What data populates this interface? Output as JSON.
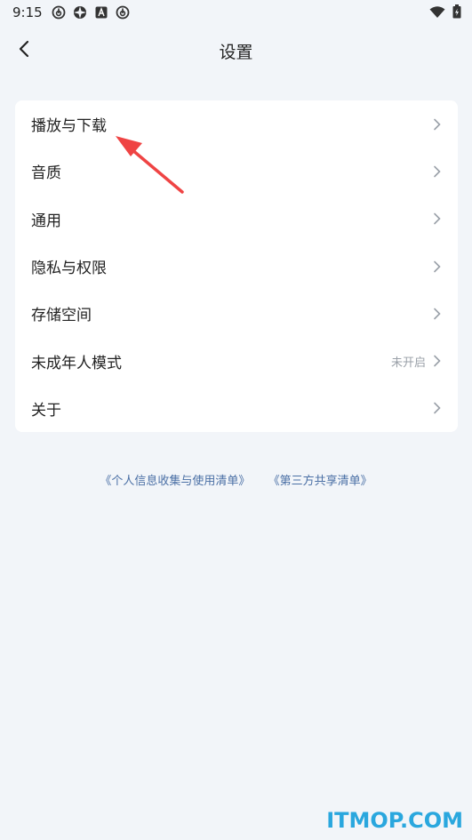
{
  "status_bar": {
    "time": "9:15",
    "left_icons": [
      "netease-music-icon",
      "aperture-icon",
      "text-app-icon",
      "netease-music-icon"
    ],
    "right_icons": [
      "wifi-icon",
      "battery-icon"
    ]
  },
  "header": {
    "title": "设置",
    "back_icon": "chevron-left-icon"
  },
  "settings_items": [
    {
      "label": "播放与下载",
      "value": ""
    },
    {
      "label": "音质",
      "value": ""
    },
    {
      "label": "通用",
      "value": ""
    },
    {
      "label": "隐私与权限",
      "value": ""
    },
    {
      "label": "存储空间",
      "value": ""
    },
    {
      "label": "未成年人模式",
      "value": "未开启"
    },
    {
      "label": "关于",
      "value": ""
    }
  ],
  "footer_links": [
    "《个人信息收集与使用清单》",
    "《第三方共享清单》"
  ],
  "watermark": "ITMOP.COM",
  "colors": {
    "background": "#f2f5f9",
    "card": "#ffffff",
    "link": "#4a6fa5",
    "annotation_arrow": "#ef4444",
    "watermark": "#2aa7de"
  }
}
